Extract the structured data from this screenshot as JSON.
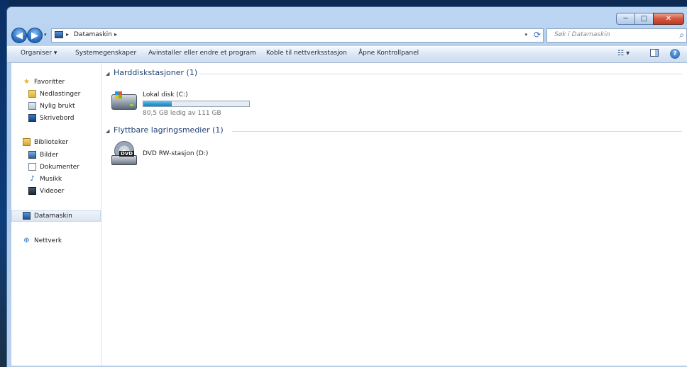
{
  "window": {
    "caption": {
      "minimize": "─",
      "maximize": "□",
      "close": "✕"
    }
  },
  "nav": {
    "back_icon": "arrow-left-icon",
    "forward_icon": "arrow-right-icon",
    "back": "◀",
    "forward": "▶",
    "history": "▾"
  },
  "address": {
    "chev": "▸",
    "crumb": "Datamaskin",
    "dropdown": "▾",
    "refresh": "⟳"
  },
  "search": {
    "placeholder": "Søk i Datamaskin",
    "icon": "⌕"
  },
  "toolbar": {
    "organize": "Organiser ▾",
    "system_properties": "Systemegenskaper",
    "uninstall": "Avinstaller eller endre et program",
    "map_drive": "Koble til nettverksstasjon",
    "control_panel": "Åpne Kontrollpanel",
    "views": "☷ ▾",
    "help": "?"
  },
  "sidebar": {
    "favorites": {
      "label": "Favoritter",
      "icon": "★"
    },
    "downloads": {
      "label": "Nedlastinger"
    },
    "recent": {
      "label": "Nylig brukt"
    },
    "desktop": {
      "label": "Skrivebord"
    },
    "libraries": {
      "label": "Biblioteker"
    },
    "pictures": {
      "label": "Bilder"
    },
    "documents": {
      "label": "Dokumenter"
    },
    "music": {
      "label": "Musikk",
      "icon": "♪"
    },
    "videos": {
      "label": "Videoer"
    },
    "computer": {
      "label": "Datamaskin"
    },
    "network": {
      "label": "Nettverk",
      "icon": "⊕"
    }
  },
  "groups": {
    "toggle": "◢",
    "hard_drives": "Harddiskstasjoner (1)",
    "removable": "Flyttbare lagringsmedier (1)"
  },
  "drives": {
    "c": {
      "name": "Lokal disk (C:)",
      "free_text": "80,5 GB ledig av 111 GB",
      "used_fraction": 0.27
    },
    "d": {
      "name": "DVD RW-stasjon (D:)",
      "badge": "DVD"
    }
  }
}
